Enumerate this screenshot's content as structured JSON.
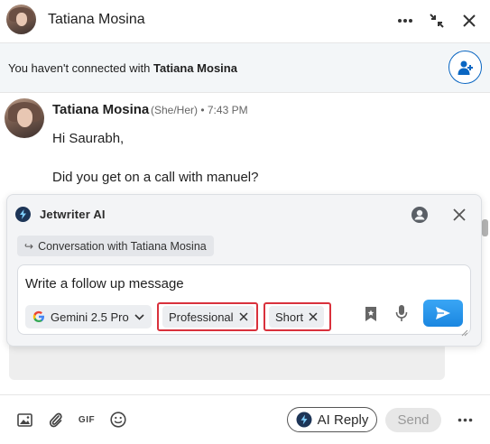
{
  "header": {
    "name": "Tatiana Mosina",
    "more_icon": "ellipsis-icon",
    "minimize_icon": "collapse-icon",
    "close_icon": "close-icon"
  },
  "banner": {
    "prefix": "You haven't connected with ",
    "name": "Tatiana Mosina",
    "connect_icon": "add-person-icon"
  },
  "message": {
    "sender": "Tatiana Mosina",
    "meta": "(She/Her) • 7:43 PM",
    "lines": [
      "Hi Saurabh,",
      "Did you get on a call with manuel?"
    ]
  },
  "jetwriter": {
    "title": "Jetwriter AI",
    "context_chip": "Conversation with Tatiana Mosina",
    "prompt": "Write a follow up message",
    "model": "Gemini 2.5 Pro",
    "tags": [
      "Professional",
      "Short"
    ]
  },
  "footer": {
    "gif_label": "GIF",
    "ai_reply_label": "AI Reply",
    "send_label": "Send"
  },
  "colors": {
    "accent": "#0a66c2",
    "highlight_border": "#d9313c",
    "send_ai": "#1a86e0"
  }
}
